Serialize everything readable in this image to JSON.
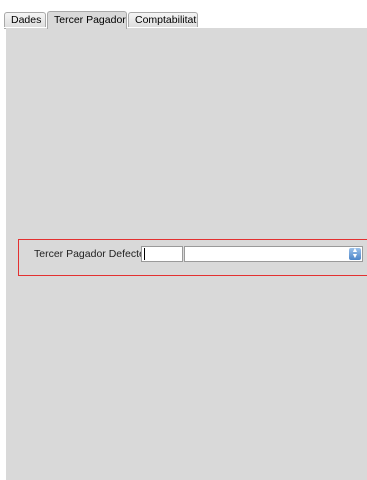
{
  "tabs": [
    {
      "label": "Dades"
    },
    {
      "label": "Tercer Pagador"
    },
    {
      "label": "Comptabilitat"
    }
  ],
  "field": {
    "label": "Tercer Pagador Defecte :",
    "code_value": "",
    "name_value": ""
  },
  "icons": {
    "combo": "spinner-arrows-icon"
  },
  "colors": {
    "highlight_border": "#e33030",
    "panel_background": "#d9d9d9",
    "combo_button": "#4d86c8"
  }
}
